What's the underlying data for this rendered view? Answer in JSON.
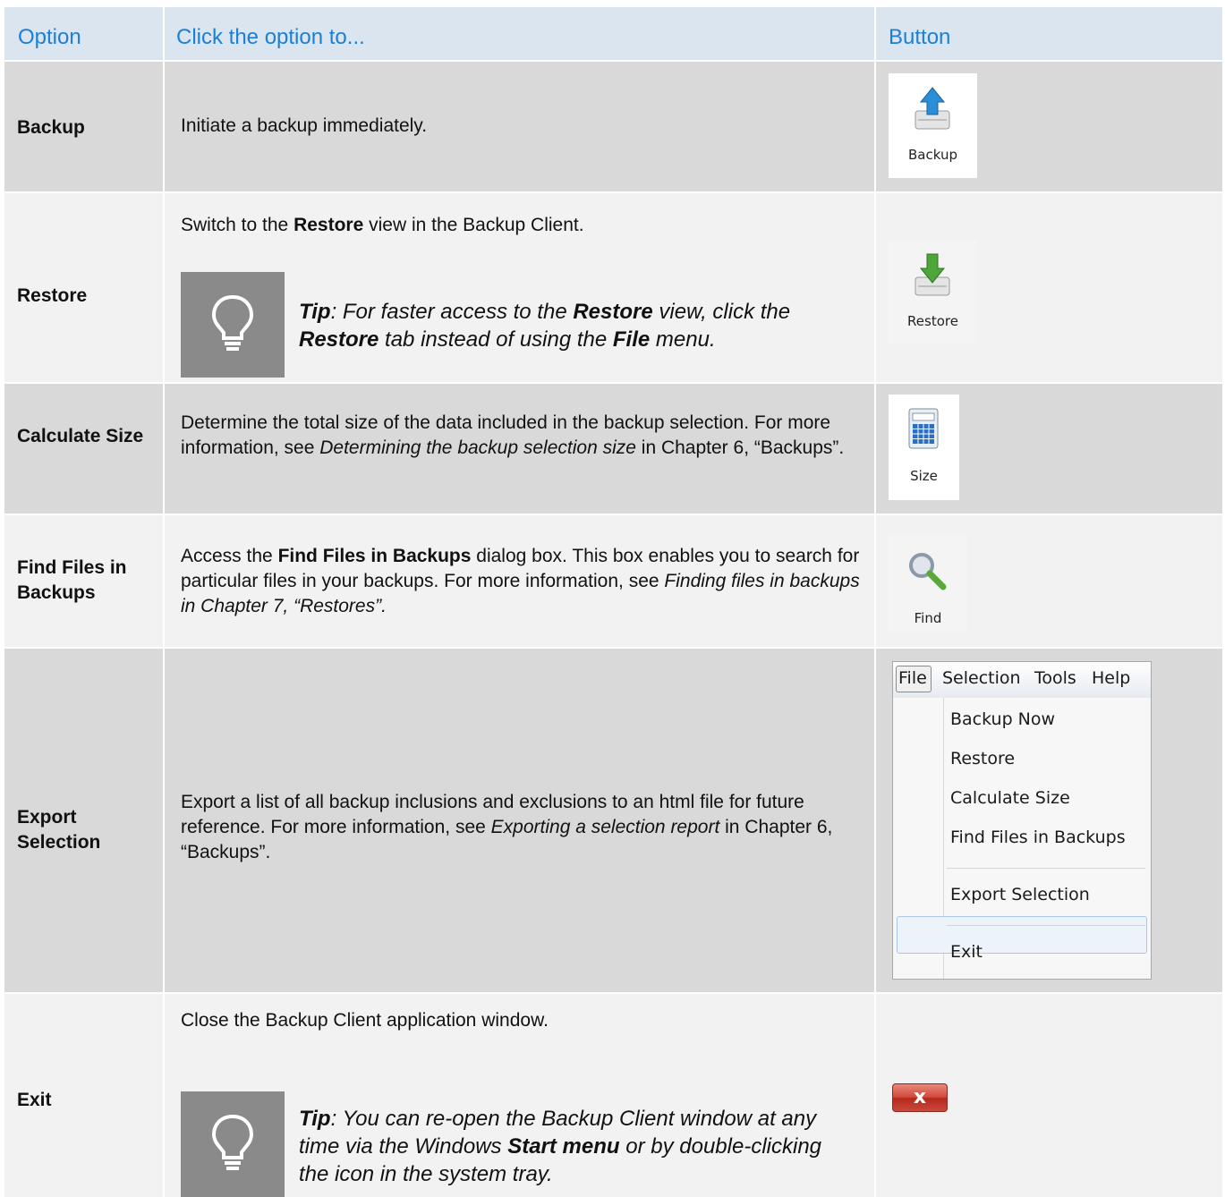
{
  "header": {
    "col_option": "Option",
    "col_click": "Click the option to...",
    "col_button": "Button"
  },
  "rows": {
    "backup": {
      "option": "Backup",
      "desc": "Initiate a backup immediately.",
      "button_label": "Backup",
      "icon": "backup-upload-icon"
    },
    "restore": {
      "option": "Restore",
      "desc_a": "Switch to the ",
      "desc_b": "Restore",
      "desc_c": " view in the Backup Client.",
      "tip": {
        "t1": "Tip",
        "t2": ": For faster access to the ",
        "t3": "Restore",
        "t4": " view, click the ",
        "t5": "Restore",
        "t6": " tab instead of using the ",
        "t7": "File",
        "t8": " menu."
      },
      "button_label": "Restore",
      "icon": "restore-download-icon"
    },
    "size": {
      "option": "Calculate Size",
      "desc_a": "Determine the total size of the data included in the backup selection. For more information, see ",
      "desc_b": "Determining the backup selection size",
      "desc_c": " in Chapter 6, “Backups”.",
      "button_label": "Size",
      "icon": "calculator-icon"
    },
    "find": {
      "option": "Find Files in Backups",
      "desc_a": "Access the ",
      "desc_b": "Find Files in Backups",
      "desc_c": " dialog box. This box enables you to search for particular files in your backups. For more information, see ",
      "desc_d": "Finding files in backups in Chapter 7, “Restores”.",
      "button_label": "Find",
      "icon": "magnifier-icon"
    },
    "export": {
      "option": "Export Selection",
      "desc_a": "Export a list of all backup inclusions and exclusions to an html file for future reference. For more information, see ",
      "desc_b": "Exporting a selection report",
      "desc_c": " in Chapter 6, “Backups”.",
      "menu": {
        "bar": [
          "File",
          "Selection",
          "Tools",
          "Help"
        ],
        "items": [
          "Backup Now",
          "Restore",
          "Calculate Size",
          "Find Files in Backups",
          "Export Selection",
          "Exit"
        ],
        "highlighted": "Export Selection"
      }
    },
    "exit": {
      "option": "Exit",
      "desc": "Close the Backup Client application window.",
      "tip": {
        "t1": "Tip",
        "t2": ": You can re-open the Backup Client window at any time via the Windows ",
        "t3": "Start menu",
        "t4": " or by double-clicking the icon in the system tray."
      },
      "button_glyph": "x"
    }
  },
  "colors": {
    "header_text": "#1a7fd6",
    "header_bg": "#dbe5ef",
    "row_dark": "#d9d9d9",
    "row_light": "#f2f2f2",
    "tip_box": "#8a8a8a"
  }
}
